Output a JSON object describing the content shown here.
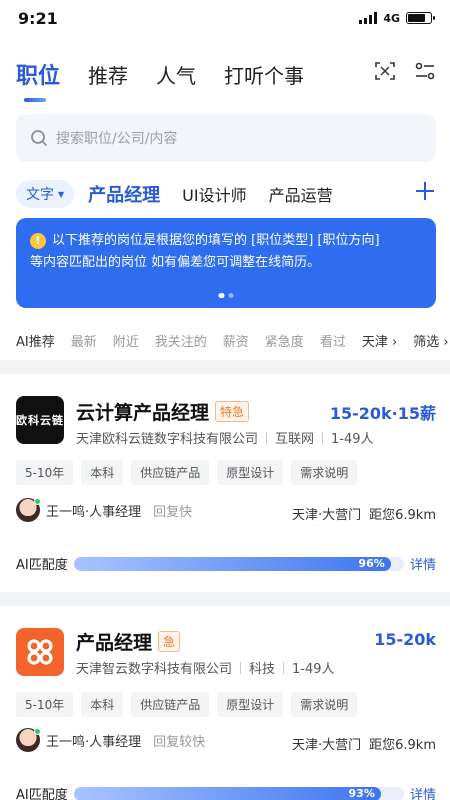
{
  "status_bar": {
    "time": "9:21",
    "network": "4G"
  },
  "top_tabs": [
    {
      "label": "职位",
      "active": true
    },
    {
      "label": "推荐",
      "active": false
    },
    {
      "label": "人气",
      "active": false
    },
    {
      "label": "打听个事",
      "active": false
    }
  ],
  "top_icons": [
    "scan-icon",
    "filter-settings-icon"
  ],
  "search": {
    "placeholder": "搜索职位/公司/内容"
  },
  "categories": {
    "dropdown_label": "文字",
    "items": [
      {
        "label": "产品经理",
        "active": true
      },
      {
        "label": "UI设计师",
        "active": false
      },
      {
        "label": "产品运营",
        "active": false
      }
    ]
  },
  "notice": {
    "line1": "以下推荐的岗位是根据您的填写的 [职位类型] [职位方向]",
    "line2": "等内容匹配出的岗位 如有偏差您可调整在线简历。",
    "page_count": 2,
    "current_page": 1
  },
  "filters": [
    "AI推荐",
    "最新",
    "附近",
    "我关注的",
    "薪资",
    "紧急度",
    "看过",
    "天津",
    "筛选"
  ],
  "jobs": [
    {
      "title": "云计算产品经理",
      "badge": "特急",
      "salary": "15-20k·15薪",
      "logo_text": "欧科云链",
      "company": "天津欧科云链数字科技有限公司",
      "industry": "互联网",
      "size": "1-49人",
      "tags": [
        "5-10年",
        "本科",
        "供应链产品",
        "原型设计",
        "需求说明"
      ],
      "recruiter": "王一鸣·人事经理",
      "reply": "回复快",
      "area": "天津·大营门",
      "distance": "距您6.9km",
      "match_label": "AI匹配度",
      "match_text": "96%",
      "match_pct": 96,
      "detail_label": "详情"
    },
    {
      "title": "产品经理",
      "badge": "急",
      "salary": "15-20k",
      "logo_text": "",
      "company": "天津智云数字科技有限公司",
      "industry": "科技",
      "size": "1-49人",
      "tags": [
        "5-10年",
        "本科",
        "供应链产品",
        "原型设计",
        "需求说明"
      ],
      "recruiter": "王一鸣·人事经理",
      "reply": "回复较快",
      "area": "天津·大营门",
      "distance": "距您6.9km",
      "match_label": "AI匹配度",
      "match_text": "93%",
      "match_pct": 93,
      "detail_label": "详情"
    }
  ],
  "colors": {
    "accent": "#2a5bd7",
    "notice_bg": "#2f6df0",
    "urgent": "#f07a2a"
  }
}
